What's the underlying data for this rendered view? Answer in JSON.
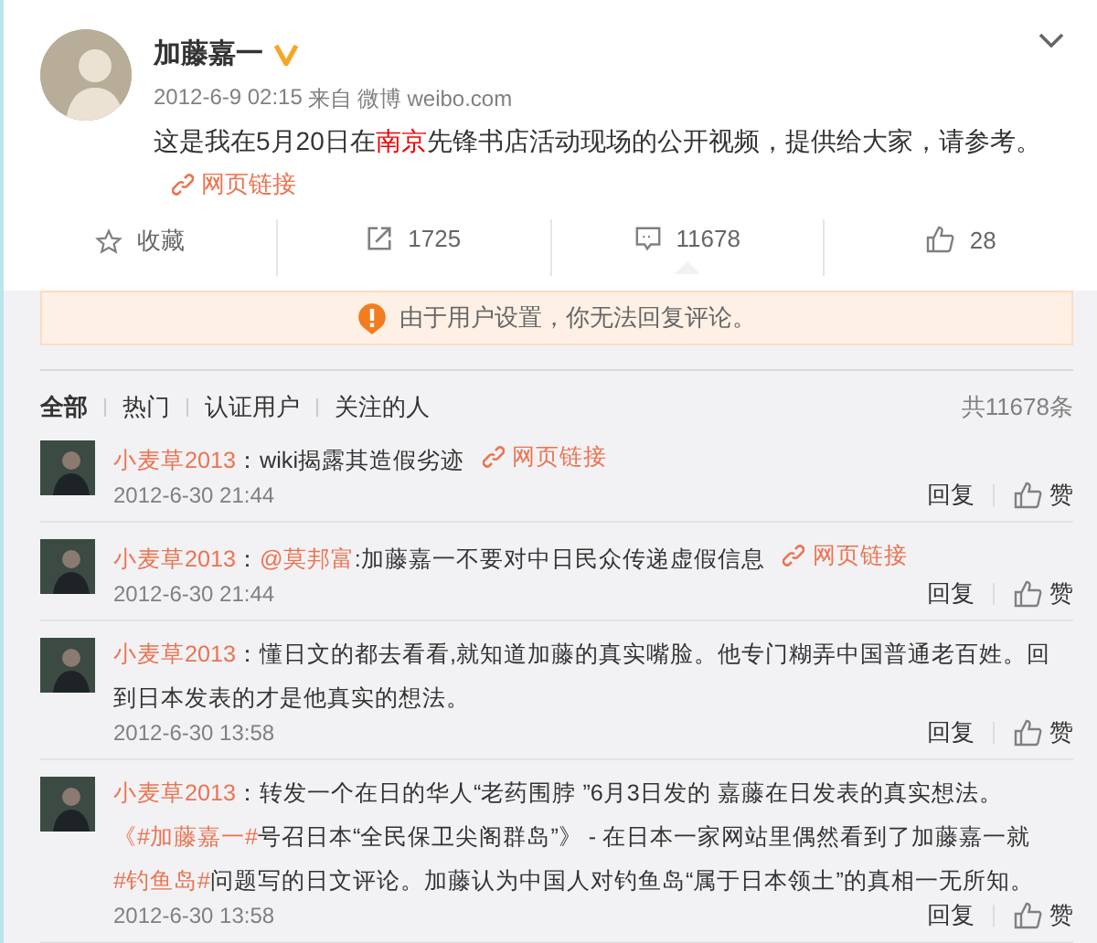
{
  "post": {
    "author": "加藤嘉一",
    "verified": true,
    "time": "2012-6-9 02:15",
    "source_prefix": "来自",
    "source": "微博 weibo.com",
    "text": [
      {
        "kind": "text",
        "text": "这是我在5月20日在"
      },
      {
        "kind": "keyword",
        "text": "南京"
      },
      {
        "kind": "text",
        "text": "先锋书店活动现场的公开视频，提供给大家，请参考。"
      }
    ],
    "link": "网页链接"
  },
  "actions": [
    {
      "kind": "favorite",
      "label": "收藏",
      "selected": false
    },
    {
      "kind": "repost",
      "label": "1725",
      "selected": false
    },
    {
      "kind": "comment",
      "label": "11678",
      "selected": true
    },
    {
      "kind": "like",
      "label": "28",
      "selected": false
    }
  ],
  "notice": "由于用户设置，你无法回复评论。",
  "comment_tabs": [
    {
      "label": "全部",
      "selected": true
    },
    {
      "label": "热门",
      "selected": false
    },
    {
      "label": "认证用户",
      "selected": false
    },
    {
      "label": "关注的人",
      "selected": false
    }
  ],
  "comment_total": "共11678条",
  "comments": [
    {
      "author": "小麦草2013",
      "body": [
        {
          "kind": "text",
          "text": "：wiki揭露其造假劣迹"
        },
        {
          "kind": "weblink",
          "text": "网页链接"
        }
      ],
      "time": "2012-6-30 21:44",
      "reply": "回复",
      "like": "赞"
    },
    {
      "author": "小麦草2013",
      "body": [
        {
          "kind": "text",
          "text": "："
        },
        {
          "kind": "mention",
          "text": "@莫邦富"
        },
        {
          "kind": "text",
          "text": ":加藤嘉一不要对中日民众传递虚假信息"
        },
        {
          "kind": "weblink",
          "text": "网页链接"
        }
      ],
      "time": "2012-6-30 21:44",
      "reply": "回复",
      "like": "赞"
    },
    {
      "author": "小麦草2013",
      "body": [
        {
          "kind": "text",
          "text": "：懂日文的都去看看,就知道加藤的真实嘴脸。他专门糊弄中国普通老百姓。回到日本发表的才是他真实的想法。"
        }
      ],
      "time": "2012-6-30 13:58",
      "reply": "回复",
      "like": "赞"
    },
    {
      "author": "小麦草2013",
      "body": [
        {
          "kind": "text",
          "text": "：转发一个在日的华人“老药围脖 ”6月3日发的 嘉藤在日发表的真实想法。 "
        },
        {
          "kind": "topic",
          "text": "《#加藤嘉一#"
        },
        {
          "kind": "text",
          "text": "号召日本“全民保卫尖阁群岛”》 - 在日本一家网站里偶然看到了加藤嘉一就"
        },
        {
          "kind": "topic",
          "text": "#钓鱼岛#"
        },
        {
          "kind": "text",
          "text": "问题写的日文评论。加藤认为中国人对钓鱼岛“属于日本领土”的真相一无所知。"
        }
      ],
      "time": "2012-6-30 13:58",
      "reply": "回复",
      "like": "赞"
    }
  ]
}
